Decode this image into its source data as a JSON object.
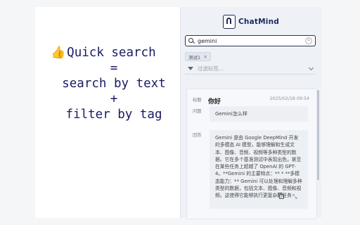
{
  "promo": {
    "line1": "Quick search",
    "line2": "=",
    "line3": "search by text",
    "line4": "+",
    "line5": "filter by tag",
    "thumb_icon": "thumbs-up-icon"
  },
  "app": {
    "name": "ChatMind"
  },
  "search": {
    "value": "gemini",
    "placeholder": "gemini"
  },
  "tags": [
    {
      "label": "测试1",
      "close": "×"
    }
  ],
  "filter": {
    "placeholder": "过滤标签..."
  },
  "card": {
    "title_label": "标题",
    "title": "你好",
    "date": "2025/02/18 09:54",
    "question_label": "问题",
    "question": "Gemini怎么样",
    "answer_label": "回答",
    "answer": "Gemini 是由 Google DeepMind 开发的多模态 AI 模型，能够理解和生成文本、图像、音频、视频等多种类型的数据。它在多个基准测试中表现出色，甚至在某些任务上超越了 OpenAI 的 GPT-4。**Gemini 的主要特点：** * **多模态能力：** Gemini 可以处理和理解多种类型的数据，包括文本、图像、音频和视频。这使得它能够执行更复杂的任务"
  },
  "colors": {
    "panel_bg": "#eef1f6",
    "promo_text": "#1a1c63",
    "brand": "#1d2a5c"
  }
}
